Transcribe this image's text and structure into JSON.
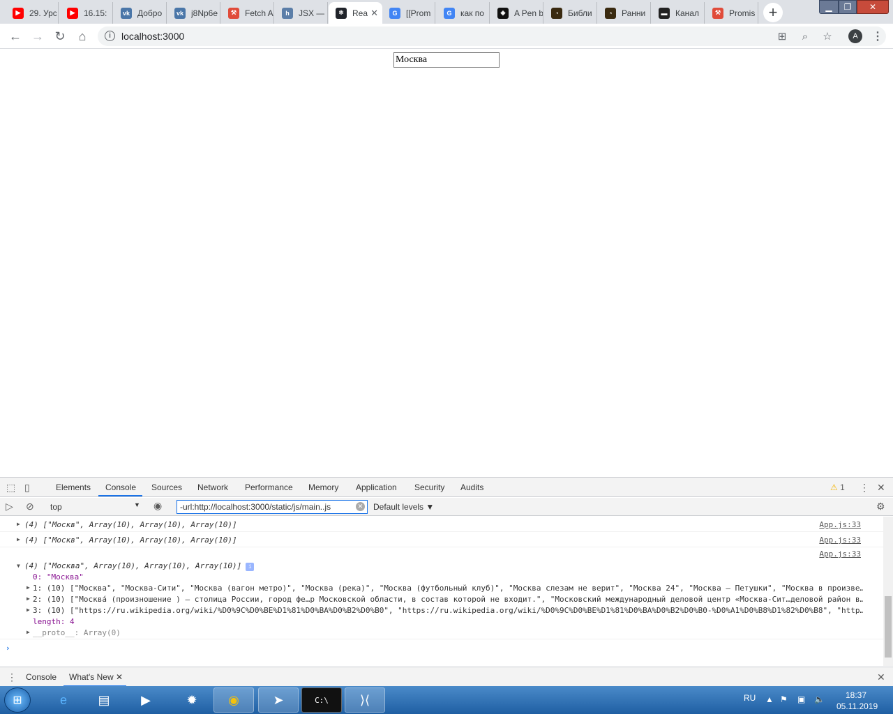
{
  "colors": {
    "tabstrip_bg": "#dee1e6",
    "accent": "#1a73e8",
    "string_red": "#c41a16",
    "taskbar": "#1f5fa3"
  },
  "browser": {
    "tabs": [
      {
        "title": "29. Урс",
        "icon": "youtube-icon",
        "color": "#ff0000",
        "glyph": "▶",
        "active": false
      },
      {
        "title": "16.15:",
        "icon": "youtube-icon",
        "color": "#ff0000",
        "glyph": "▶",
        "active": false
      },
      {
        "title": "Добро",
        "icon": "vk-icon",
        "color": "#4a76a8",
        "glyph": "vk",
        "active": false
      },
      {
        "title": "j8Np6e",
        "icon": "vk-icon",
        "color": "#4a76a8",
        "glyph": "vk",
        "active": false
      },
      {
        "title": "Fetch A",
        "icon": "mdn-icon",
        "color": "#e04b3a",
        "glyph": "⚒",
        "active": false
      },
      {
        "title": "JSX —",
        "icon": "hexlet-icon",
        "color": "#5b7ea8",
        "glyph": "h",
        "active": false
      },
      {
        "title": "Rea",
        "icon": "react-icon",
        "color": "#20232a",
        "glyph": "⚛",
        "active": true
      },
      {
        "title": "[[Prom",
        "icon": "google-icon",
        "color": "#4285f4",
        "glyph": "G",
        "active": false
      },
      {
        "title": "как по",
        "icon": "google-icon",
        "color": "#4285f4",
        "glyph": "G",
        "active": false
      },
      {
        "title": "A Pen b",
        "icon": "codepen-icon",
        "color": "#111111",
        "glyph": "◈",
        "active": false
      },
      {
        "title": "Библи",
        "icon": "glasses-icon",
        "color": "#3a2a10",
        "glyph": "◔",
        "active": false
      },
      {
        "title": "Ранни",
        "icon": "glasses-icon",
        "color": "#3a2a10",
        "glyph": "◔",
        "active": false
      },
      {
        "title": "Канал",
        "icon": "terminal-icon",
        "color": "#222222",
        "glyph": "▬",
        "active": false
      },
      {
        "title": "Promis",
        "icon": "mdn-icon",
        "color": "#e04b3a",
        "glyph": "⚒",
        "active": false
      }
    ],
    "url": "localhost:3000",
    "avatar_letter": "A"
  },
  "page": {
    "city_input_value": "Москва"
  },
  "devtools": {
    "tabs": [
      "Elements",
      "Console",
      "Sources",
      "Network",
      "Performance",
      "Memory",
      "Application",
      "Security",
      "Audits"
    ],
    "active_tab": "Console",
    "warning_count": "1",
    "context": "top",
    "filter_value": "-url:http://localhost:3000/static/js/main..js",
    "levels": "Default levels ▼",
    "logs": [
      {
        "text": "(4) [\"Москв\", Array(10), Array(10), Array(10)]",
        "source": "App.js:33"
      },
      {
        "text": "(4) [\"Москв\", Array(10), Array(10), Array(10)]",
        "source": "App.js:33"
      },
      {
        "text": "(4) [\"Москва\", Array(10), Array(10), Array(10)]",
        "source": "App.js:33"
      }
    ],
    "expanded": {
      "item0": "0: \"Москва\"",
      "item1": "1: (10) [\"Москва\", \"Москва-Сити\", \"Москва (вагон метро)\", \"Москва (река)\", \"Москва (футбольный клуб)\", \"Москва слезам не верит\", \"Москва 24\", \"Москва — Петушки\", \"Москва в произве…",
      "item2": "2: (10) [\"Москва́ (произношение ) — столица России, город фе…р Московской области, в состав которой не входит.\", \"Московский международный деловой центр «Москва-Сит…деловой район в…",
      "item3": "3: (10) [\"https://ru.wikipedia.org/wiki/%D0%9C%D0%BE%D1%81%D0%BA%D0%B2%D0%B0\", \"https://ru.wikipedia.org/wiki/%D0%9C%D0%BE%D1%81%D0%BA%D0%B2%D0%B0-%D0%A1%D0%B8%D1%82%D0%B8\", \"http…",
      "length": "length: 4",
      "proto": "__proto__: Array(0)"
    },
    "drawer_tabs": [
      "Console",
      "What's New"
    ]
  },
  "taskbar": {
    "apps": [
      {
        "name": "ie-icon",
        "glyph": "e"
      },
      {
        "name": "explorer-icon",
        "glyph": "▤"
      },
      {
        "name": "media-player-icon",
        "glyph": "▶"
      },
      {
        "name": "settings-app-icon",
        "glyph": "✹"
      },
      {
        "name": "chrome-icon",
        "glyph": "◉"
      },
      {
        "name": "telegram-icon",
        "glyph": "➤"
      },
      {
        "name": "cmd-icon",
        "glyph": "C:\\"
      },
      {
        "name": "vscode-icon",
        "glyph": "⟩⟨"
      }
    ],
    "lang": "RU",
    "time": "18:37",
    "date": "05.11.2019"
  }
}
